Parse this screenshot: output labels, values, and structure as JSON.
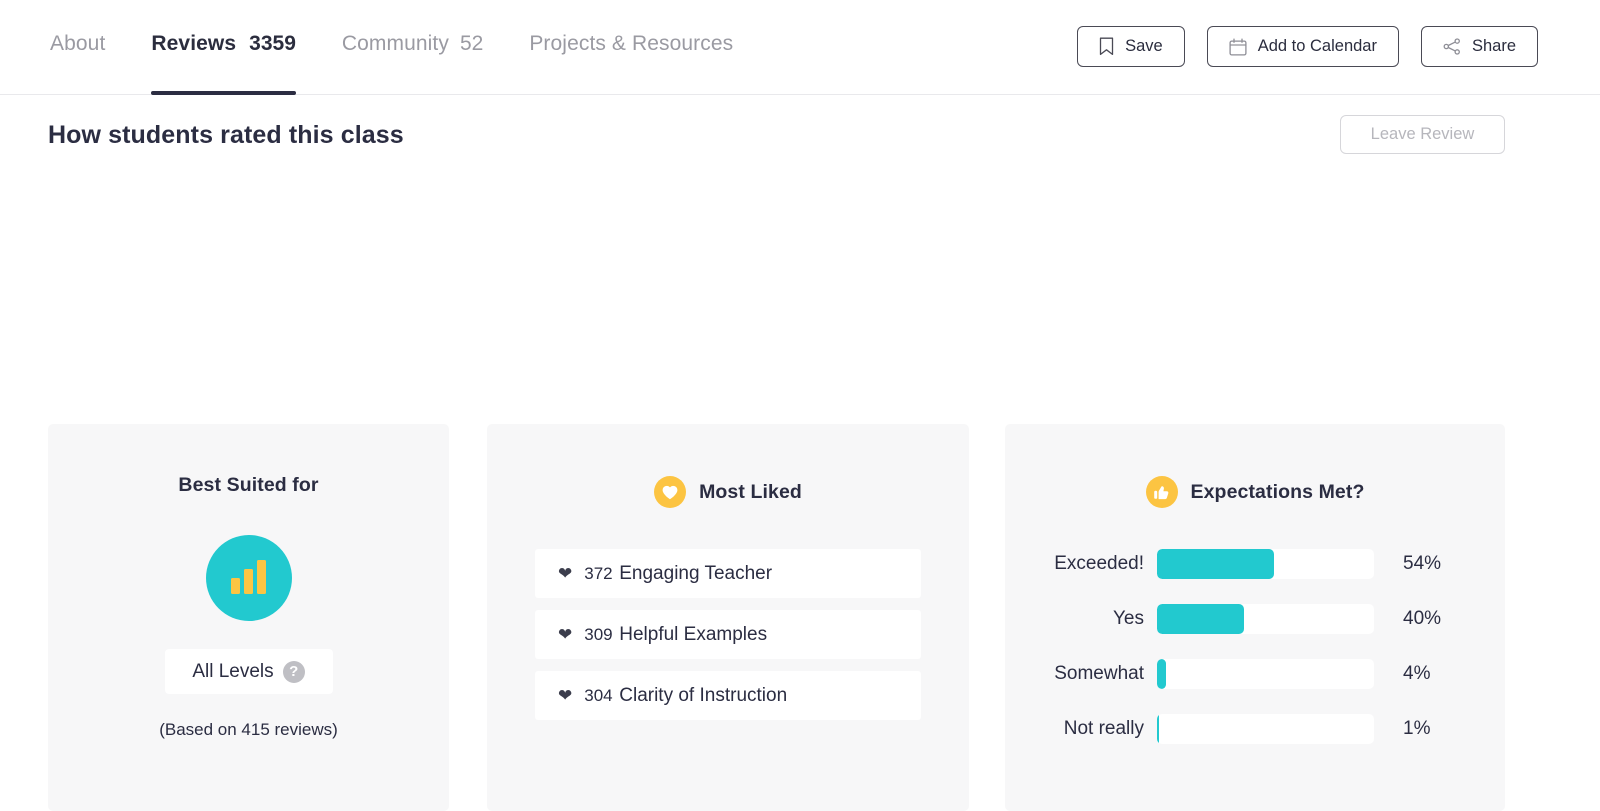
{
  "header": {
    "tabs": [
      {
        "label": "About",
        "count": "",
        "active": false
      },
      {
        "label": "Reviews",
        "count": "3359",
        "active": true
      },
      {
        "label": "Community",
        "count": "52",
        "active": false
      },
      {
        "label": "Projects & Resources",
        "count": "",
        "active": false
      }
    ],
    "actions": [
      {
        "label": "Save",
        "icon": "bookmark-icon"
      },
      {
        "label": "Add to Calendar",
        "icon": "calendar-icon"
      },
      {
        "label": "Share",
        "icon": "share-icon"
      }
    ]
  },
  "section": {
    "title": "How students rated this class",
    "leave_review_label": "Leave Review"
  },
  "cards": {
    "best_suited": {
      "title": "Best Suited for",
      "icon": "bar-chart-icon",
      "level": "All Levels",
      "help_icon": "question-mark-icon",
      "based_on": "(Based on 415 reviews)"
    },
    "most_liked": {
      "title": "Most Liked",
      "icon": "heart-icon",
      "items": [
        {
          "count": "372",
          "label": "Engaging Teacher",
          "icon": "heart-icon"
        },
        {
          "count": "309",
          "label": "Helpful Examples",
          "icon": "heart-icon"
        },
        {
          "count": "304",
          "label": "Clarity of Instruction",
          "icon": "heart-icon"
        }
      ]
    },
    "expectations": {
      "title": "Expectations Met?",
      "icon": "thumbs-up-icon",
      "rows": [
        {
          "label": "Exceeded!",
          "pct_label": "54%",
          "pct": 54
        },
        {
          "label": "Yes",
          "pct_label": "40%",
          "pct": 40
        },
        {
          "label": "Somewhat",
          "pct_label": "4%",
          "pct": 4
        },
        {
          "label": "Not really",
          "pct_label": "1%",
          "pct": 1
        }
      ]
    }
  },
  "colors": {
    "teal": "#22c9cf",
    "amber": "#fcc442",
    "ink": "#2b2d42",
    "muted": "#9a9aa2",
    "card_bg": "#f7f7f8"
  }
}
